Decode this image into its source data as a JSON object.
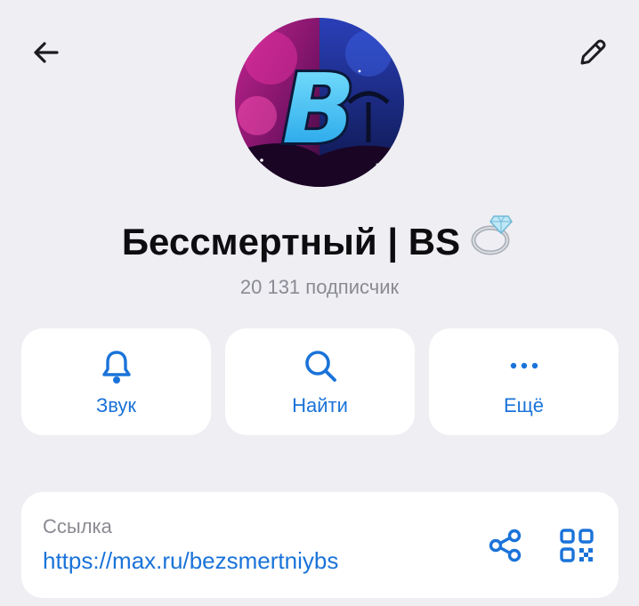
{
  "header": {
    "back_icon": "arrow-left-icon",
    "edit_icon": "pencil-icon"
  },
  "channel": {
    "name": "Бессмертный | BS",
    "name_emoji": "ring-emoji",
    "avatar_letter": "B",
    "subscribers": "20 131 подписчик"
  },
  "actions": [
    {
      "label": "Звук",
      "icon": "bell-icon"
    },
    {
      "label": "Найти",
      "icon": "search-icon"
    },
    {
      "label": "Ещё",
      "icon": "more-dots-icon"
    }
  ],
  "link": {
    "label": "Ссылка",
    "url": "https://max.ru/bezsmertniybs",
    "share_icon": "share-icon",
    "qr_icon": "qr-code-icon"
  },
  "colors": {
    "accent": "#1a73d9",
    "background": "#eeeef3",
    "card": "#ffffff",
    "secondary_text": "#8a8a93"
  }
}
